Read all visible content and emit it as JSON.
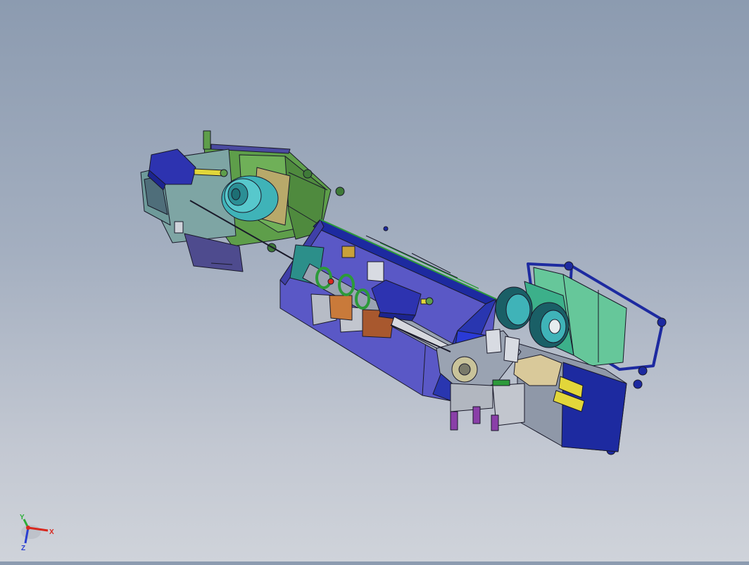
{
  "scene": {
    "background_top": "#8c9bb0",
    "background_bottom": "#cfd3da",
    "model_colors": {
      "base_blue": "#5a58c6",
      "frame_navy": "#1d2aa0",
      "steel_gray": "#8f98a8",
      "olive_green": "#5e9e4a",
      "teal": "#3fb3b8",
      "seafoam": "#66c79a",
      "khaki": "#b8a96a",
      "yellow": "#e2d63a",
      "orange": "#c97a3a",
      "violet": "#8a3fa8",
      "outline": "#1a1a2a"
    }
  },
  "triad": {
    "x_label": "X",
    "y_label": "Y",
    "z_label": "Z",
    "x_color": "#d8281e",
    "y_color": "#2cae38",
    "z_color": "#2a3ed0"
  }
}
